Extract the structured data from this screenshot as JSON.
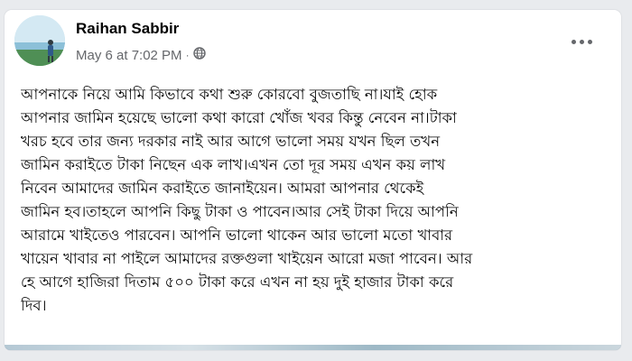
{
  "post": {
    "author": "Raihan Sabbir",
    "timestamp": "May 6 at 7:02 PM",
    "separator": "·",
    "audience_icon": "globe-icon",
    "more_icon": "more-options-icon",
    "text_lines": [
      "আপনাকে নিয়ে আমি কিভাবে কথা শুরু কোরবো বুজতাছি না।যাই হোক",
      "আপনার জামিন হয়েছে ভালো কথা কারো খোঁজ খবর কিন্তু নেবেন না।টাকা",
      "খরচ হবে তার জন্য দরকার নাই আর আগে ভালো সময় যখন ছিল তখন",
      "জামিন করাইতে টাকা নিছেন এক লাখ।এখন তো দূর সময় এখন কয় লাখ",
      "নিবেন  আমাদের জামিন করাইতে  জানাইয়েন। আমরা আপনার থেকেই",
      "জামিন হব।তাহলে আপনি কিছু টাকা ও পাবেন।আর সেই টাকা দিয়ে আপনি",
      "আরামে খাইতেও পারবেন। আপনি ভালো থাকেন আর ভালো মতো খাবার",
      "খায়েন খাবার না পাইলে আমাদের রক্তগুলা খাইয়েন আরো মজা পাবেন। আর",
      "হে আগে হাজিরা দিতাম ৫০০ টাকা করে এখন না হয় দুই হাজার টাকা করে",
      "দিব।"
    ]
  },
  "colors": {
    "page_bg": "#e9ebee",
    "card_bg": "#ffffff",
    "primary_text": "#050505",
    "secondary_text": "#65676b"
  }
}
